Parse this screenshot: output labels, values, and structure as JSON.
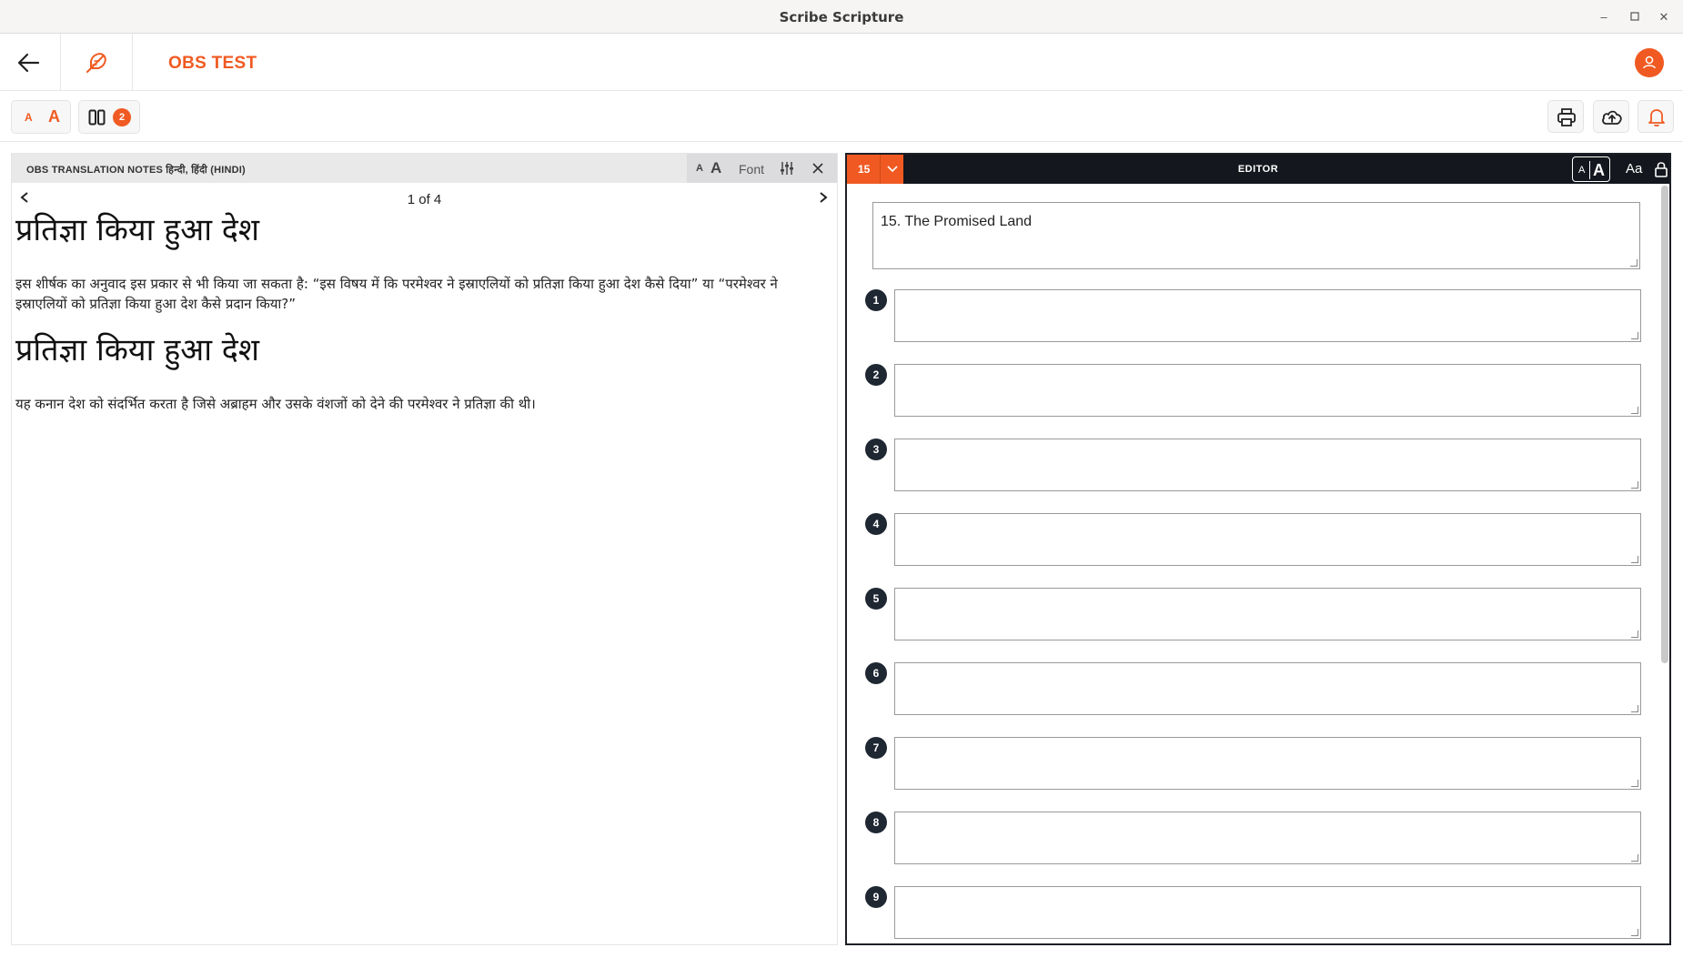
{
  "window": {
    "title": "Scribe Scripture"
  },
  "header": {
    "project_name": "OBS TEST"
  },
  "toolbar": {
    "resources_count": "2"
  },
  "left_pane": {
    "title": "OBS TRANSLATION NOTES हिन्दी, हिंदी (HINDI)",
    "font_label": "Font",
    "pager": "1 of 4",
    "notes": [
      {
        "heading": "प्रतिज्ञा किया हुआ देश",
        "body": "इस शीर्षक का अनुवाद इस प्रकार से भी किया जा सकता है: “इस विषय में कि परमेश्वर ने इस्राएलियों को प्रतिज्ञा किया हुआ देश कैसे दिया” या “परमेश्वर ने इस्राएलियों को प्रतिज्ञा किया हुआ देश कैसे प्रदान किया?”"
      },
      {
        "heading": "प्रतिज्ञा किया हुआ देश",
        "body": "यह कनान देश को संदर्भित करता है जिसे अब्राहम और उसके वंशजों को देने की परमेश्वर ने प्रतिज्ञा की थी।"
      }
    ]
  },
  "editor": {
    "chapter": "15",
    "title": "EDITOR",
    "aa_label": "Aa",
    "story_title": "15. The Promised Land",
    "verses": [
      "1",
      "2",
      "3",
      "4",
      "5",
      "6",
      "7",
      "8",
      "9"
    ]
  },
  "colors": {
    "accent": "#f05a22",
    "editor_header": "#15171e"
  }
}
